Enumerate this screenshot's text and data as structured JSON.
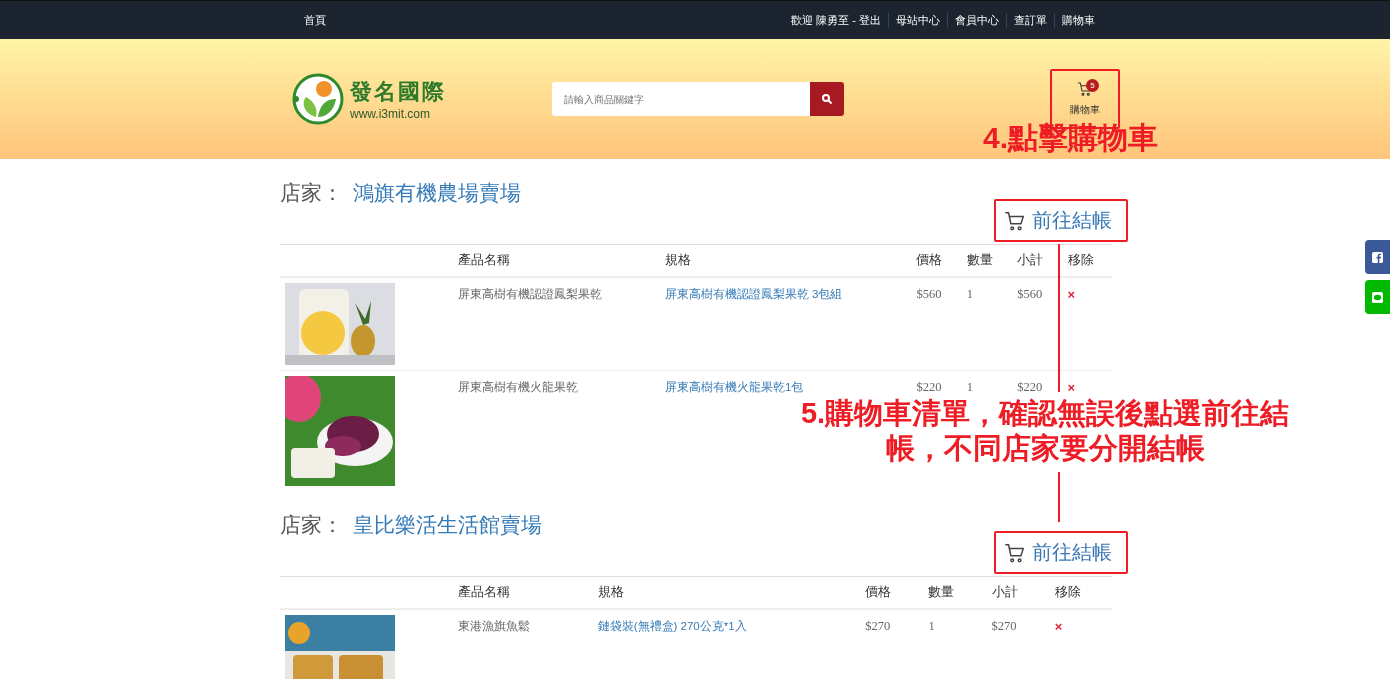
{
  "nav": {
    "left_links": [
      "首頁"
    ],
    "right_links": [
      "歡迎 陳勇至 - 登出",
      "母站中心",
      "會員中心",
      "查訂單",
      "購物車"
    ]
  },
  "header": {
    "logo": {
      "name": "發名國際",
      "url": "www.i3mit.com"
    },
    "search": {
      "placeholder": "請輸入商品關鍵字"
    },
    "cart": {
      "label": "購物車",
      "count": "5"
    }
  },
  "annotations": [
    {
      "text": "4.點擊購物車"
    },
    {
      "text": "5.購物車清單，確認無誤後點選前往結帳，不同店家要分開結帳"
    }
  ],
  "stores": [
    {
      "label": "店家：",
      "name": "鴻旗有機農場賣場",
      "checkout": "前往結帳",
      "columns": [
        "產品名稱",
        "規格",
        "價格",
        "數量",
        "小計",
        "移除"
      ],
      "rows": [
        {
          "name": "屏東高樹有機認證鳳梨果乾",
          "spec": "屏東高樹有機認證鳳梨果乾 3包組",
          "price": "$560",
          "qty": "1",
          "subtotal": "$560",
          "remove": "×"
        },
        {
          "name": "屏東高樹有機火龍果乾",
          "spec": "屏東高樹有機火龍果乾1包",
          "price": "$220",
          "qty": "1",
          "subtotal": "$220",
          "remove": "×"
        }
      ]
    },
    {
      "label": "店家：",
      "name": "皇比樂活生活館賣場",
      "checkout": "前往結帳",
      "columns": [
        "產品名稱",
        "規格",
        "價格",
        "數量",
        "小計",
        "移除"
      ],
      "rows": [
        {
          "name": "東港漁旗魚鬆",
          "spec": "鏈袋裝(無禮盒) 270公克*1入",
          "price": "$270",
          "qty": "1",
          "subtotal": "$270",
          "remove": "×"
        }
      ]
    }
  ]
}
